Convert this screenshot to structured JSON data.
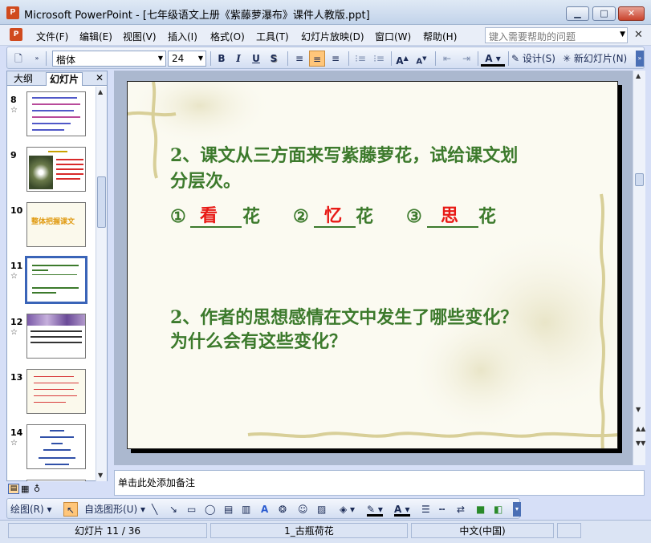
{
  "window": {
    "title": "Microsoft PowerPoint - [七年级语文上册《紫藤萝瀑布》课件人教版.ppt]",
    "app_icon": "powerpoint-icon"
  },
  "menu": {
    "items": [
      "文件(F)",
      "编辑(E)",
      "视图(V)",
      "插入(I)",
      "格式(O)",
      "工具(T)",
      "幻灯片放映(D)",
      "窗口(W)",
      "帮助(H)"
    ],
    "help_placeholder": "键入需要帮助的问题"
  },
  "toolbar": {
    "font_name": "楷体",
    "font_size": "24",
    "bold": "B",
    "italic": "I",
    "underline": "U",
    "shadow": "S",
    "design_label": "设计(S)",
    "new_slide_label": "新幻灯片(N)",
    "active_alignment": "center"
  },
  "left_pane": {
    "tab_outline": "大纲",
    "tab_slides": "幻灯片",
    "selected_slide": 11,
    "slides": [
      {
        "num": "8",
        "star": true
      },
      {
        "num": "9",
        "star": false
      },
      {
        "num": "10",
        "star": false,
        "thumb_text": "整体把握课文"
      },
      {
        "num": "11",
        "star": true
      },
      {
        "num": "12",
        "star": true
      },
      {
        "num": "13",
        "star": false
      },
      {
        "num": "14",
        "star": true
      }
    ]
  },
  "slide": {
    "q1_line1": "2、课文从三方面来写紫藤萝花，试给课文划",
    "q1_line2": "分层次。",
    "blank1_prefix": "①",
    "blank1_answer": "看",
    "blank1_suffix": "花",
    "blank2_prefix": "②",
    "blank2_answer": "忆",
    "blank2_suffix": "花",
    "blank3_prefix": "③",
    "blank3_answer": "思",
    "blank3_suffix": "花",
    "q2_line1": "2、作者的思想感情在文中发生了哪些变化？",
    "q2_line2": "为什么会有这些变化？",
    "colors": {
      "text": "#3c7a2c",
      "answer": "#e81a16"
    }
  },
  "notes": {
    "placeholder": "单击此处添加备注"
  },
  "draw_toolbar": {
    "draw_label": "绘图(R)",
    "autoshape_label": "自选图形(U)"
  },
  "status": {
    "slide_info": "幻灯片 11 / 36",
    "design_name": "1_古瓶荷花",
    "language": "中文(中国)"
  }
}
